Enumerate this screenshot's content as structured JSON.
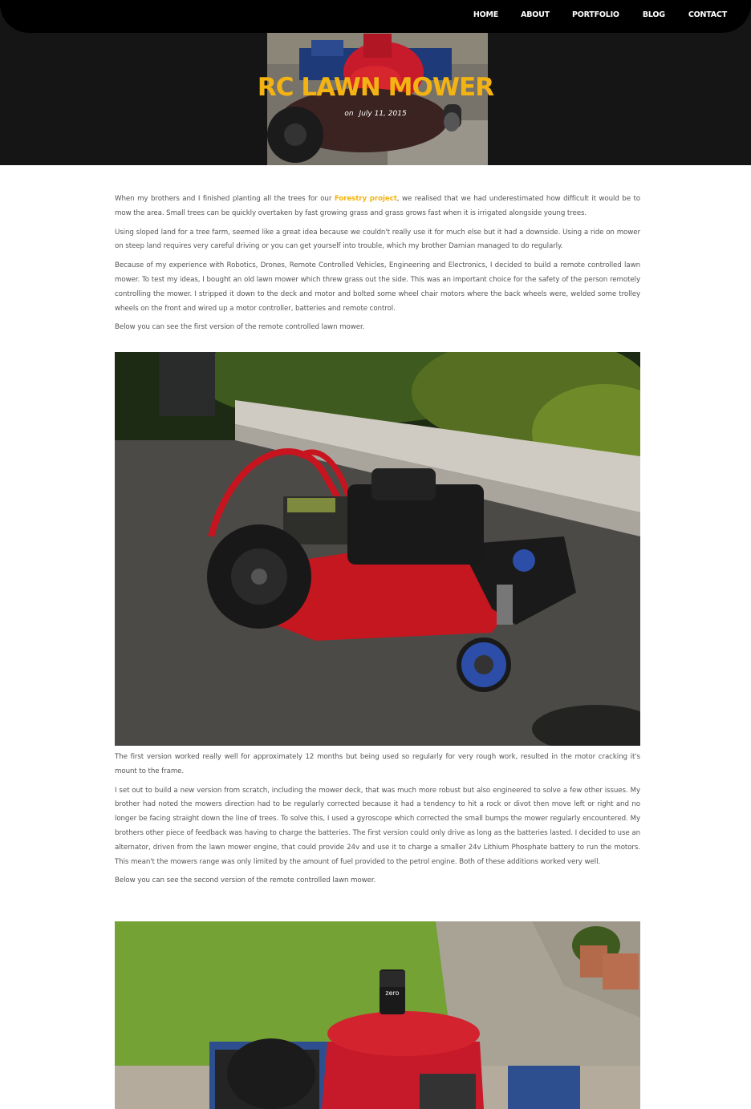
{
  "nav": {
    "home": "HOME",
    "about": "ABOUT",
    "portfolio": "PORTFOLIO",
    "blog": "BLOG",
    "contact": "CONTACT"
  },
  "post": {
    "title": "RC LAWN MOWER",
    "date_prefix": "on",
    "date": "July 11, 2015"
  },
  "article": {
    "p1_before": "When my brothers and I finished planting all the trees for our ",
    "p1_link": "Forestry project",
    "p1_after": ", we realised that we had underestimated how difficult it would be to mow the area. Small trees can be quickly overtaken by fast growing grass and grass grows fast when it is irrigated alongside young trees.",
    "p2": "Using sloped land for a tree farm, seemed like a great idea because we couldn't really use it for much else but it had a downside. Using a ride on mower on steep land requires very careful driving or you can get yourself into trouble, which my brother Damian managed to do regularly.",
    "p3": "Because of my experience with Robotics, Drones, Remote Controlled Vehicles, Engineering and Electronics, I decided to build a remote controlled lawn mower. To test my ideas, I bought an old lawn mower which threw grass out the side. This was an important choice for the safety of the person remotely controlling the mower. I stripped it down to the deck and motor and bolted some wheel chair motors where the back wheels were, welded some trolley wheels on the front and wired up a motor controller, batteries and remote control.",
    "p4": "Below you can see the first version of the remote controlled lawn mower.",
    "p5": "The first version worked really well for approximately 12 months but being used so regularly for very rough work, resulted in the motor cracking it's mount to the frame.",
    "p6": "I set out to build a new version from scratch, including the mower deck, that was much more robust but also engineered to solve a few other issues. My brother had noted the mowers direction had to be regularly corrected because it had a tendency to hit a rock or divot then move left or right and no longer be facing straight down the line of trees. To solve this, I used a gyroscope which corrected the small bumps the mower regularly encountered. My brothers other piece of feedback was having to charge the batteries. The first version could only drive as long as the batteries lasted. I decided to use an alternator, driven from the lawn mower engine, that could provide 24v and use it to charge a smaller 24v Lithium Phosphate battery to run the motors. This mean't the mowers range was only limited by the amount of fuel provided to the petrol engine. Both of these additions worked very well.",
    "p7": "Below you can see the second version of the remote controlled lawn mower."
  },
  "can_label": "zero",
  "colors": {
    "accent": "#f3b313",
    "header_bg": "#151515",
    "nav_bg": "#000000"
  }
}
